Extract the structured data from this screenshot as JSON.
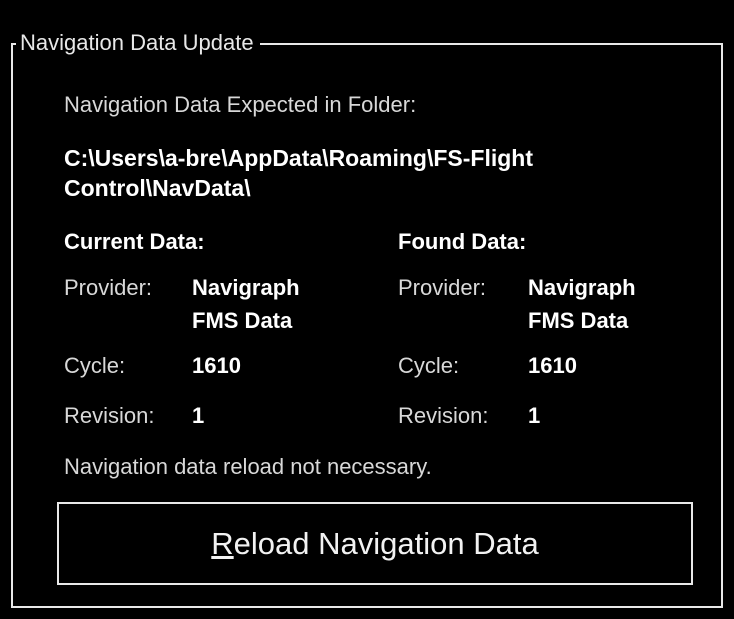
{
  "group": {
    "title": "Navigation Data Update"
  },
  "folder": {
    "label": "Navigation Data Expected in Folder:",
    "path_line1": "C:\\Users\\a-bre\\AppData\\Roaming\\FS-Flight",
    "path_line2": "Control\\NavData\\"
  },
  "current": {
    "heading": "Current Data:",
    "provider_label": "Provider:",
    "provider_line1": "Navigraph",
    "provider_line2": "FMS Data",
    "cycle_label": "Cycle:",
    "cycle_value": "1610",
    "revision_label": "Revision:",
    "revision_value": "1"
  },
  "found": {
    "heading": "Found Data:",
    "provider_label": "Provider:",
    "provider_line1": "Navigraph",
    "provider_line2": "FMS Data",
    "cycle_label": "Cycle:",
    "cycle_value": "1610",
    "revision_label": "Revision:",
    "revision_value": "1"
  },
  "status": {
    "message": "Navigation data reload not necessary."
  },
  "reload_button": {
    "mnemonic": "R",
    "rest": "eload Navigation Data"
  },
  "colors": {
    "background": "#000000",
    "foreground": "#e6e6e6",
    "border": "#e8e8e8"
  }
}
